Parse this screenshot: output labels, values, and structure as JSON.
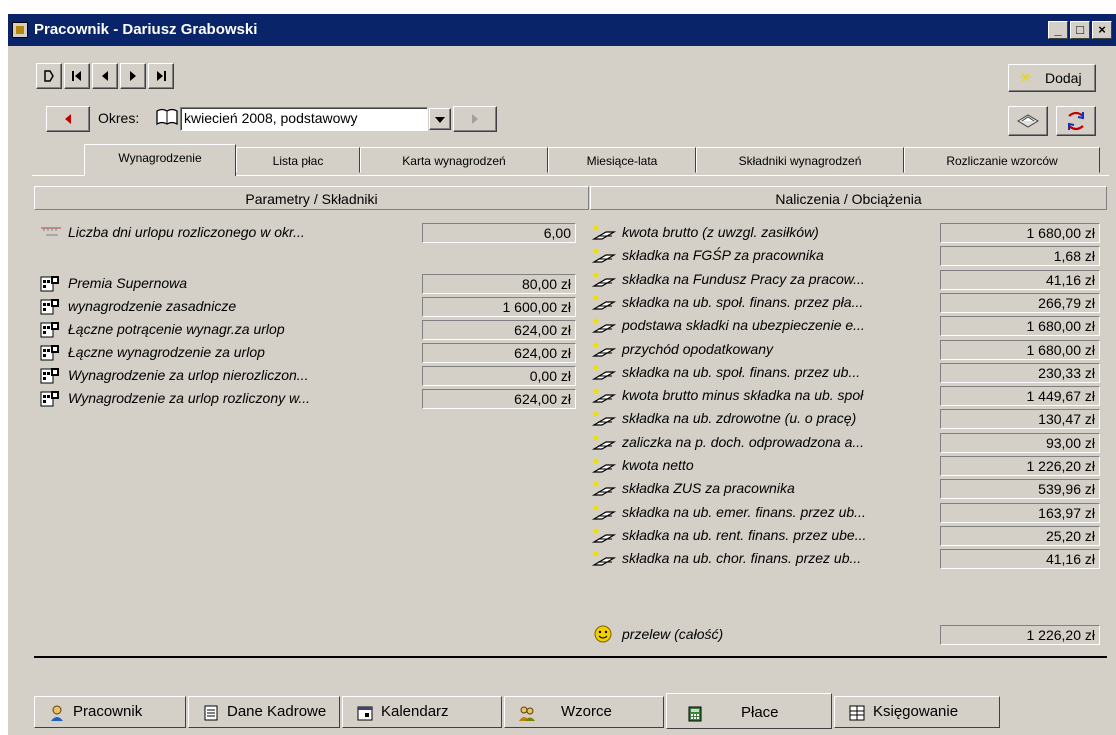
{
  "window": {
    "title": "Pracownik - Dariusz Grabowski",
    "controls": [
      "_",
      "□",
      "×"
    ]
  },
  "toolbar": {
    "add_label": "Dodaj",
    "period_label": "Okres:",
    "period_value": "kwiecień 2008, podstawowy"
  },
  "tabs": [
    {
      "label": "Wynagrodzenie",
      "active": true
    },
    {
      "label": "Lista płac",
      "active": false
    },
    {
      "label": "Karta wynagrodzeń",
      "active": false
    },
    {
      "label": "Miesiące-lata",
      "active": false
    },
    {
      "label": "Składniki wynagrodzeń",
      "active": false
    },
    {
      "label": "Rozliczanie wzorców",
      "active": false
    }
  ],
  "left_header": "Parametry / Składniki",
  "right_header": "Naliczenia / Obciążenia",
  "left_rows": [
    {
      "label": "Liczba dni urlopu rozliczonego w okr...",
      "value": "6,00",
      "icon": "ruler-icon"
    },
    {
      "label": "Premia Supernowa",
      "value": "80,00 zł",
      "icon": "component-icon"
    },
    {
      "label": "wynagrodzenie zasadnicze",
      "value": "1 600,00 zł",
      "icon": "component-icon"
    },
    {
      "label": "Łączne potrącenie wynagr.za urlop",
      "value": "624,00 zł",
      "icon": "component-icon"
    },
    {
      "label": "Łączne wynagrodzenie za urlop",
      "value": "624,00 zł",
      "icon": "component-icon"
    },
    {
      "label": "Wynagrodzenie za urlop nierozliczon...",
      "value": "0,00 zł",
      "icon": "component-icon"
    },
    {
      "label": "Wynagrodzenie za urlop rozliczony w...",
      "value": "624,00 zł",
      "icon": "component-icon"
    }
  ],
  "right_rows": [
    {
      "label": "kwota brutto (z uwzgl. zasiłków)",
      "value": "1 680,00 zł"
    },
    {
      "label": "składka na FGŚP za pracownika",
      "value": "1,68 zł"
    },
    {
      "label": "składka na Fundusz Pracy za pracow...",
      "value": "41,16 zł"
    },
    {
      "label": "składka na ub. społ. finans. przez pła...",
      "value": "266,79 zł"
    },
    {
      "label": "podstawa składki na ubezpieczenie e...",
      "value": "1 680,00 zł"
    },
    {
      "label": "przychód opodatkowany",
      "value": "1 680,00 zł"
    },
    {
      "label": "składka na ub. społ. finans. przez ub...",
      "value": "230,33 zł"
    },
    {
      "label": "kwota brutto minus składka na ub. społ",
      "value": "1 449,67 zł"
    },
    {
      "label": "składka na ub. zdrowotne (u. o pracę)",
      "value": "130,47 zł"
    },
    {
      "label": "zaliczka na p. doch. odprowadzona a...",
      "value": "93,00 zł"
    },
    {
      "label": "kwota netto",
      "value": "1 226,20 zł"
    },
    {
      "label": "składka ZUS za pracownika",
      "value": "539,96 zł"
    },
    {
      "label": "składka na ub. emer. finans. przez ub...",
      "value": "163,97 zł"
    },
    {
      "label": "składka na ub. rent. finans. przez ube...",
      "value": "25,20 zł"
    },
    {
      "label": "składka na ub. chor. finans. przez ub...",
      "value": "41,16 zł"
    }
  ],
  "transfer_row": {
    "label": "przelew (całość)",
    "value": "1 226,20 zł"
  },
  "bottom_tabs": [
    {
      "label": "Pracownik",
      "icon": "person-icon"
    },
    {
      "label": "Dane Kadrowe",
      "icon": "document-icon"
    },
    {
      "label": "Kalendarz",
      "icon": "calendar-icon"
    },
    {
      "label": "Wzorce",
      "icon": "people-icon"
    },
    {
      "label": "Płace",
      "icon": "calculator-icon",
      "active": true
    },
    {
      "label": "Księgowanie",
      "icon": "ledger-icon"
    }
  ]
}
